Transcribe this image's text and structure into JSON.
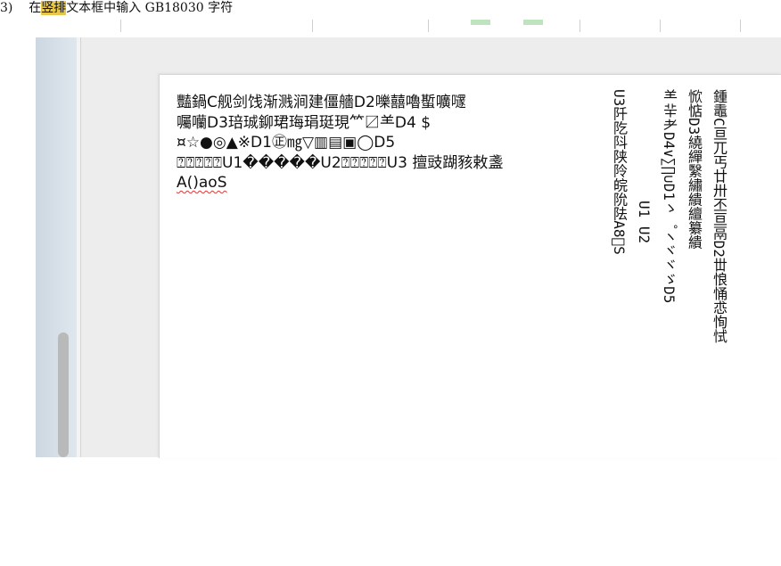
{
  "caption": {
    "num": "3)",
    "pre": "在",
    "highlight": "竖排",
    "post": "文本框中输入 GB18030 字符"
  },
  "horizontal_text": {
    "lines": [
      "豔鍋C舰剑饯渐溅涧建僵艢D2嚛囍嚕蟴嚝嚺",
      "囑囒D3琣珹鉚珺珻琄珽現⺮〼⺷D4 $",
      "¤☆●◎▲※D1㊣㎎▽▥▤▣◯D5",
      "⍰⍰⍰⍰⍰U1�����U2⍰⍰⍰⍰⍰U3 擅豉䠒豥敕盞",
      "A()aoS"
    ]
  },
  "vertical_text": {
    "col1": "鍾鼃C亘兀丐廿卅丕亘鬲D2丗悢悀怷恂恜",
    "col2": "惞惦D3繞繟繄繡繢繵纂繢",
    "col3": "⺷⺸⺹D4∨∑∏∪D1ゝ゜ヽヾヾゞD5",
    "col4": "U1 U2",
    "col5": "U3阡阣阧陕阾皖阭阹A8゙S"
  },
  "colors": {
    "caption_highlight": "#e8c84a",
    "page": "#ffffff",
    "workspace": "#f3f3f3",
    "spellcheck": "#e03131"
  }
}
